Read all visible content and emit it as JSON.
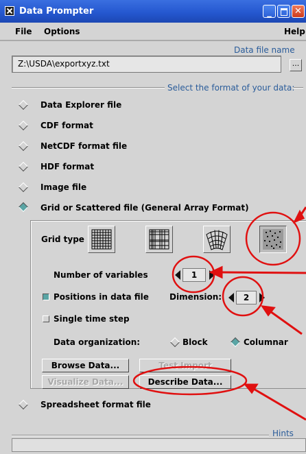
{
  "window": {
    "title": "Data Prompter"
  },
  "menu": {
    "file": "File",
    "options": "Options",
    "help": "Help"
  },
  "datafile": {
    "label": "Data file name",
    "value": "Z:\\USDA\\exportxyz.txt",
    "browse": "..."
  },
  "format_section": {
    "label": "Select the format of your data:"
  },
  "formats": [
    {
      "label": "Data Explorer file",
      "selected": false
    },
    {
      "label": "CDF format",
      "selected": false
    },
    {
      "label": "NetCDF format file",
      "selected": false
    },
    {
      "label": "HDF format",
      "selected": false
    },
    {
      "label": "Image file",
      "selected": false
    },
    {
      "label": "Grid or Scattered file (General Array Format)",
      "selected": true
    }
  ],
  "grid": {
    "grid_type_label": "Grid type",
    "grid_type_icons": [
      "regular-grid-icon",
      "irregular-grid-icon",
      "curvilinear-grid-icon",
      "scattered-points-icon"
    ],
    "num_vars_label": "Number of variables",
    "num_vars_value": "1",
    "positions_label": "Positions in data file",
    "positions_checked": true,
    "dimension_label": "Dimension:",
    "dimension_value": "2",
    "single_time_label": "Single time step",
    "single_time_checked": false,
    "organization_label": "Data organization:",
    "block_label": "Block",
    "columnar_label": "Columnar",
    "columnar_selected": true
  },
  "buttons": {
    "browse": "Browse Data...",
    "test_import": "Test Import",
    "visualize": "Visualize Data...",
    "describe": "Describe Data..."
  },
  "spreadsheet": {
    "label": "Spreadsheet format file",
    "selected": false
  },
  "hints": {
    "label": "Hints"
  },
  "colors": {
    "titlebar": "#2558d0",
    "accent_label": "#2a5c9a",
    "selected_toggle": "#5aa5a5",
    "annotation": "#e01010"
  }
}
